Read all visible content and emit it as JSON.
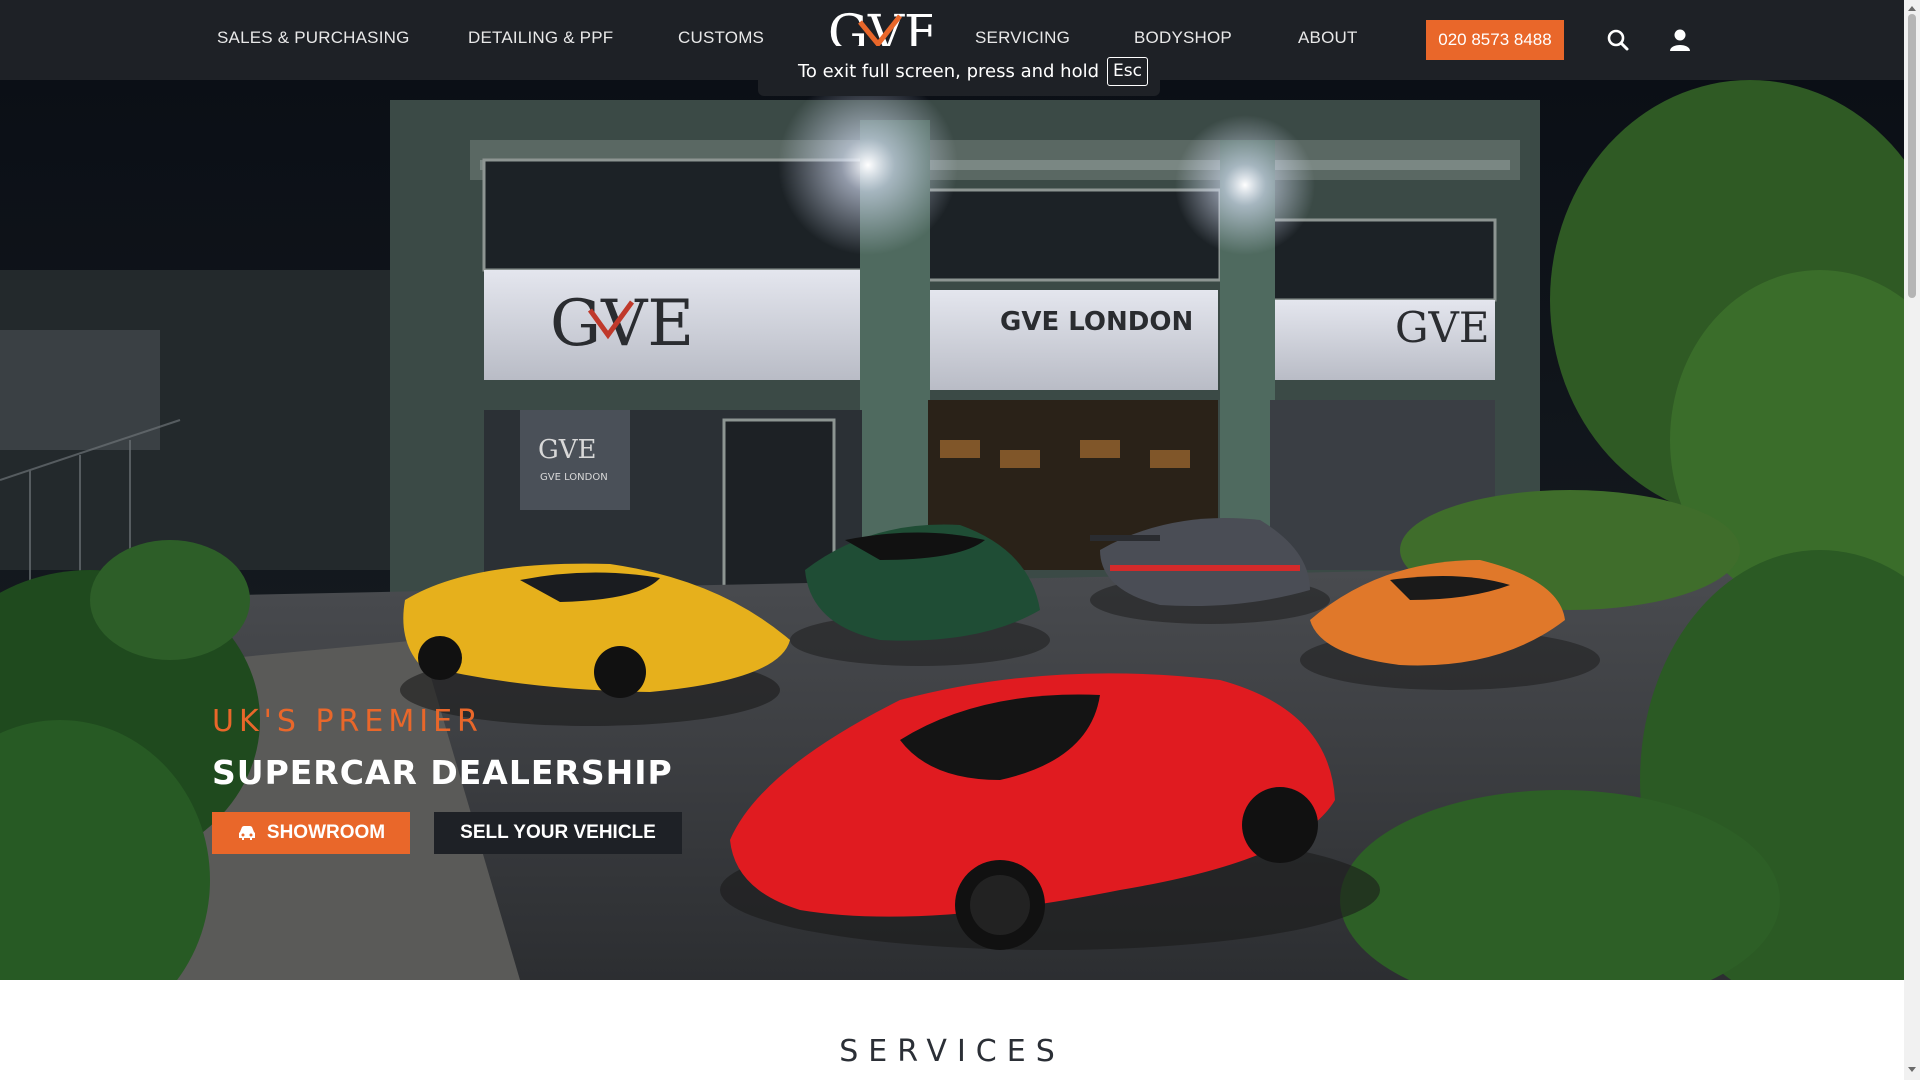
{
  "nav": {
    "items": [
      {
        "label": "SALES & PURCHASING"
      },
      {
        "label": "DETAILING & PPF"
      },
      {
        "label": "CUSTOMS"
      },
      {
        "label": "SERVICING"
      },
      {
        "label": "BODYSHOP"
      },
      {
        "label": "ABOUT"
      }
    ],
    "phone": "020 8573 8488",
    "logo_text": "GVE",
    "icons": [
      "search-icon",
      "user-icon"
    ]
  },
  "fullscreen_notice": {
    "text": "To exit full screen, press and hold",
    "key": "Esc"
  },
  "hero": {
    "kicker": "UK'S PREMIER",
    "title": "SUPERCAR DEALERSHIP",
    "showroom_label": "SHOWROOM",
    "sell_label": "SELL YOUR VEHICLE",
    "building_sign": "GVE LONDON",
    "small_sign": "GVE LONDON"
  },
  "services": {
    "heading": "SERVICES"
  },
  "colors": {
    "accent": "#e9672a",
    "nav_bg": "#1e2126",
    "text_dark": "#2b2f36"
  }
}
